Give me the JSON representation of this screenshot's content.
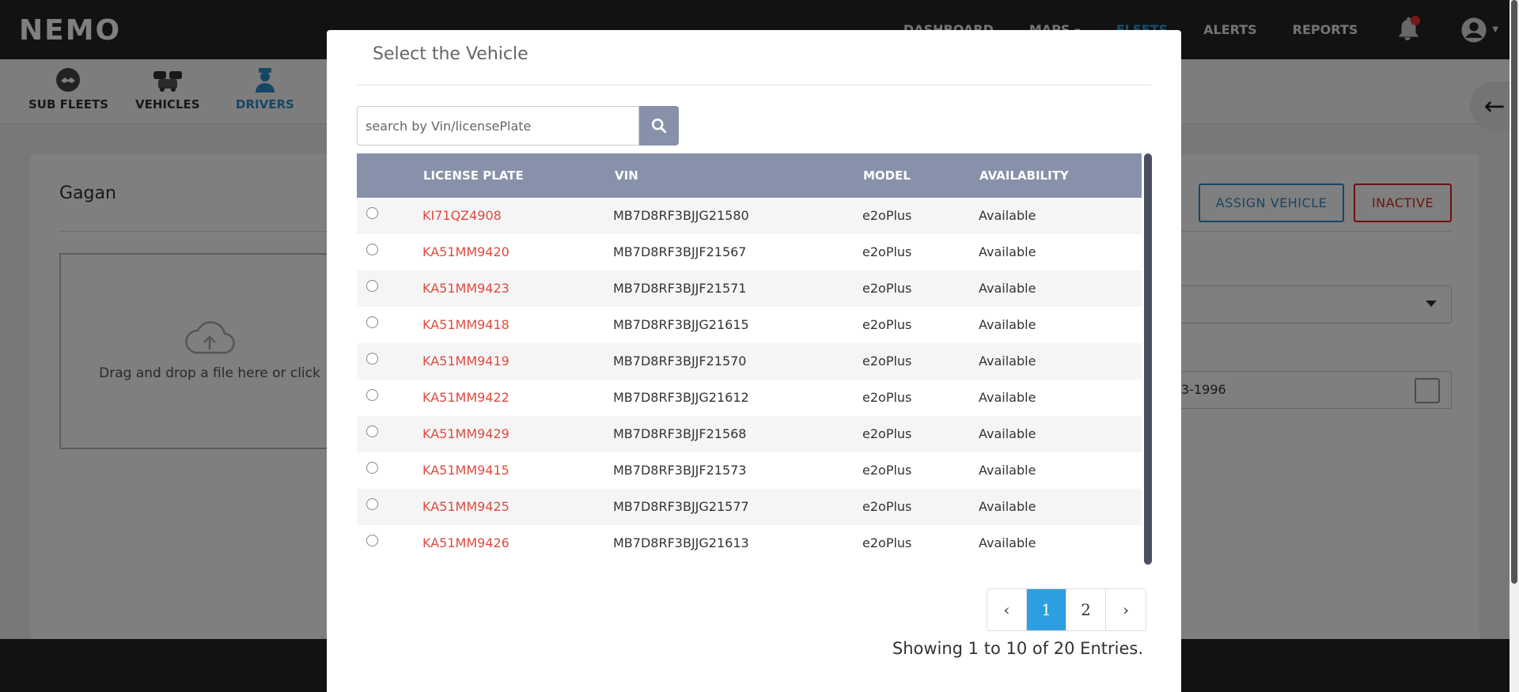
{
  "app": {
    "logo": "NEMO",
    "nav": {
      "dashboard": "DASHBOARD",
      "maps": "MAPS",
      "fleets": "FLEETS",
      "alerts": "ALERTS",
      "reports": "REPORTS"
    },
    "accent_color": "#2d9fe0",
    "alert_color": "#e02020"
  },
  "subnav": {
    "sub_fleets": "SUB FLEETS",
    "vehicles": "VEHICLES",
    "drivers": "DRIVERS"
  },
  "driver_card": {
    "name": "Gagan",
    "dropzone_text": "Drag and drop a file here or click",
    "assign_label": "ASSIGN VEHICLE",
    "inactive_label": "INACTIVE",
    "date_partial": "3-1996"
  },
  "modal": {
    "title": "Select the Vehicle",
    "search_placeholder": "search by Vin/licensePlate",
    "columns": {
      "license_plate": "LICENSE PLATE",
      "vin": "VIN",
      "model": "MODEL",
      "availability": "AVAILABILITY"
    },
    "rows": [
      {
        "plate": "KI71QZ4908",
        "vin": "MB7D8RF3BJJG21580",
        "model": "e2oPlus",
        "availability": "Available"
      },
      {
        "plate": "KA51MM9420",
        "vin": "MB7D8RF3BJJF21567",
        "model": "e2oPlus",
        "availability": "Available"
      },
      {
        "plate": "KA51MM9423",
        "vin": "MB7D8RF3BJJF21571",
        "model": "e2oPlus",
        "availability": "Available"
      },
      {
        "plate": "KA51MM9418",
        "vin": "MB7D8RF3BJJG21615",
        "model": "e2oPlus",
        "availability": "Available"
      },
      {
        "plate": "KA51MM9419",
        "vin": "MB7D8RF3BJJF21570",
        "model": "e2oPlus",
        "availability": "Available"
      },
      {
        "plate": "KA51MM9422",
        "vin": "MB7D8RF3BJJG21612",
        "model": "e2oPlus",
        "availability": "Available"
      },
      {
        "plate": "KA51MM9429",
        "vin": "MB7D8RF3BJJF21568",
        "model": "e2oPlus",
        "availability": "Available"
      },
      {
        "plate": "KA51MM9415",
        "vin": "MB7D8RF3BJJF21573",
        "model": "e2oPlus",
        "availability": "Available"
      },
      {
        "plate": "KA51MM9425",
        "vin": "MB7D8RF3BJJG21577",
        "model": "e2oPlus",
        "availability": "Available"
      },
      {
        "plate": "KA51MM9426",
        "vin": "MB7D8RF3BJJG21613",
        "model": "e2oPlus",
        "availability": "Available"
      }
    ],
    "pagination": {
      "prev": "‹",
      "pages": [
        "1",
        "2"
      ],
      "current_page": "1",
      "next": "›"
    },
    "entries_text": "Showing 1 to 10 of 20 Entries."
  }
}
